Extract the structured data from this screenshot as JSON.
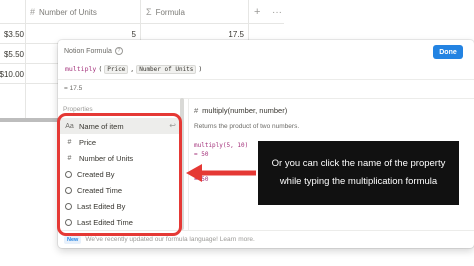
{
  "table": {
    "headers": {
      "units_icon": "#",
      "units_label": "Number of Units",
      "formula_icon": "Σ",
      "formula_label": "Formula",
      "add_icon": "+",
      "more_icon": "···"
    },
    "rows": [
      {
        "price": "$3.50",
        "units": "5",
        "formula": "17.5"
      },
      {
        "price": "$5.50",
        "units": "",
        "formula": ""
      },
      {
        "price": "$10.00",
        "units": "",
        "formula": ""
      }
    ]
  },
  "popup": {
    "title": "Notion Formula",
    "done_label": "Done",
    "formula": {
      "function": "multiply",
      "open": "(",
      "arg1": "Price",
      "separator": ",",
      "arg2": "Number of Units",
      "close": ")"
    },
    "result": "= 17.5",
    "properties_heading": "Properties",
    "properties": [
      {
        "icon": "Aa",
        "label": "Name of item"
      },
      {
        "icon": "#",
        "label": "Price"
      },
      {
        "icon": "#",
        "label": "Number of Units"
      },
      {
        "icon": "person-circle",
        "label": "Created By"
      },
      {
        "icon": "clock-circle",
        "label": "Created Time"
      },
      {
        "icon": "person-circle",
        "label": "Last Edited By"
      },
      {
        "icon": "clock-circle",
        "label": "Last Edited Time"
      }
    ],
    "enter_icon": "↩",
    "doc": {
      "icon": "#",
      "signature": "multiply(number, number)",
      "description": "Returns the product of two numbers.",
      "example": "multiply(5, 10)",
      "example_result": "= 50",
      "example_result_2": "= 50"
    },
    "footer": {
      "badge": "New",
      "text": "We've recently updated our formula language! Learn more."
    }
  },
  "callout": {
    "text": "Or you can click the name of the property while typing the multiplication formula"
  },
  "colors": {
    "accent": "#2383e2",
    "highlight": "#e53935",
    "callout_bg": "#111111"
  }
}
